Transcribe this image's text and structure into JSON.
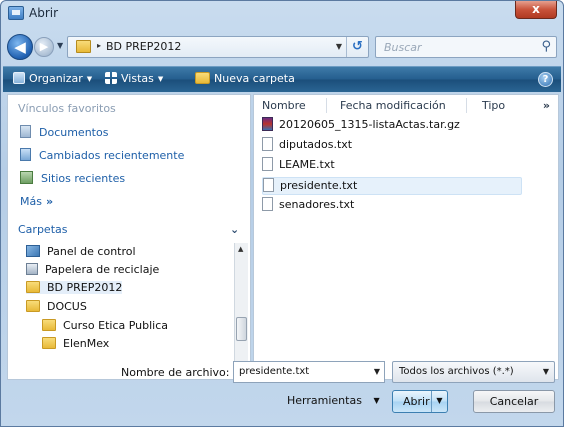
{
  "window": {
    "title": "Abrir",
    "close_label": "x"
  },
  "address": {
    "path": "BD PREP2012",
    "separator": "▸",
    "search_placeholder": "Buscar"
  },
  "toolbar": {
    "organize": "Organizar",
    "views": "Vistas",
    "new_folder": "Nueva carpeta",
    "help": "?"
  },
  "favorites": {
    "header": "Vínculos favoritos",
    "items": [
      {
        "label": "Documentos",
        "icon": "documents-icon"
      },
      {
        "label": "Cambiados recientemente",
        "icon": "recent-icon"
      },
      {
        "label": "Sitios recientes",
        "icon": "recent-sites-icon"
      }
    ],
    "more": "Más",
    "more_glyph": "»"
  },
  "folders": {
    "header": "Carpetas",
    "chevron": "⌄",
    "items": [
      {
        "label": "Panel de control",
        "icon": "control-panel-icon"
      },
      {
        "label": "Papelera de reciclaje",
        "icon": "recycle-bin-icon"
      },
      {
        "label": "BD PREP2012",
        "icon": "folder-icon"
      },
      {
        "label": "DOCUS",
        "icon": "folder-icon"
      },
      {
        "label": "Curso Etica Publica",
        "icon": "folder-icon"
      },
      {
        "label": "ElenMex",
        "icon": "folder-icon"
      }
    ]
  },
  "file_list": {
    "columns": [
      "Nombre",
      "Fecha modificación",
      "Tipo"
    ],
    "more": "»",
    "files": [
      {
        "name": "20120605_1315-listaActas.tar.gz",
        "icon": "archive-icon"
      },
      {
        "name": "diputados.txt",
        "icon": "text-file-icon"
      },
      {
        "name": "LEAME.txt",
        "icon": "text-file-icon"
      },
      {
        "name": "presidente.txt",
        "icon": "text-file-icon",
        "selected": true
      },
      {
        "name": "senadores.txt",
        "icon": "text-file-icon"
      }
    ]
  },
  "footer": {
    "filename_label": "Nombre de archivo:",
    "filename_value": "presidente.txt",
    "filter_value": "Todos los archivos (*.*)",
    "tools_label": "Herramientas",
    "open_label": "Abrir",
    "cancel_label": "Cancelar"
  },
  "colors": {
    "toolbar": "#245d8e",
    "link": "#1e5fa8",
    "selection": "#e6f1fb",
    "close": "#c9533b"
  }
}
